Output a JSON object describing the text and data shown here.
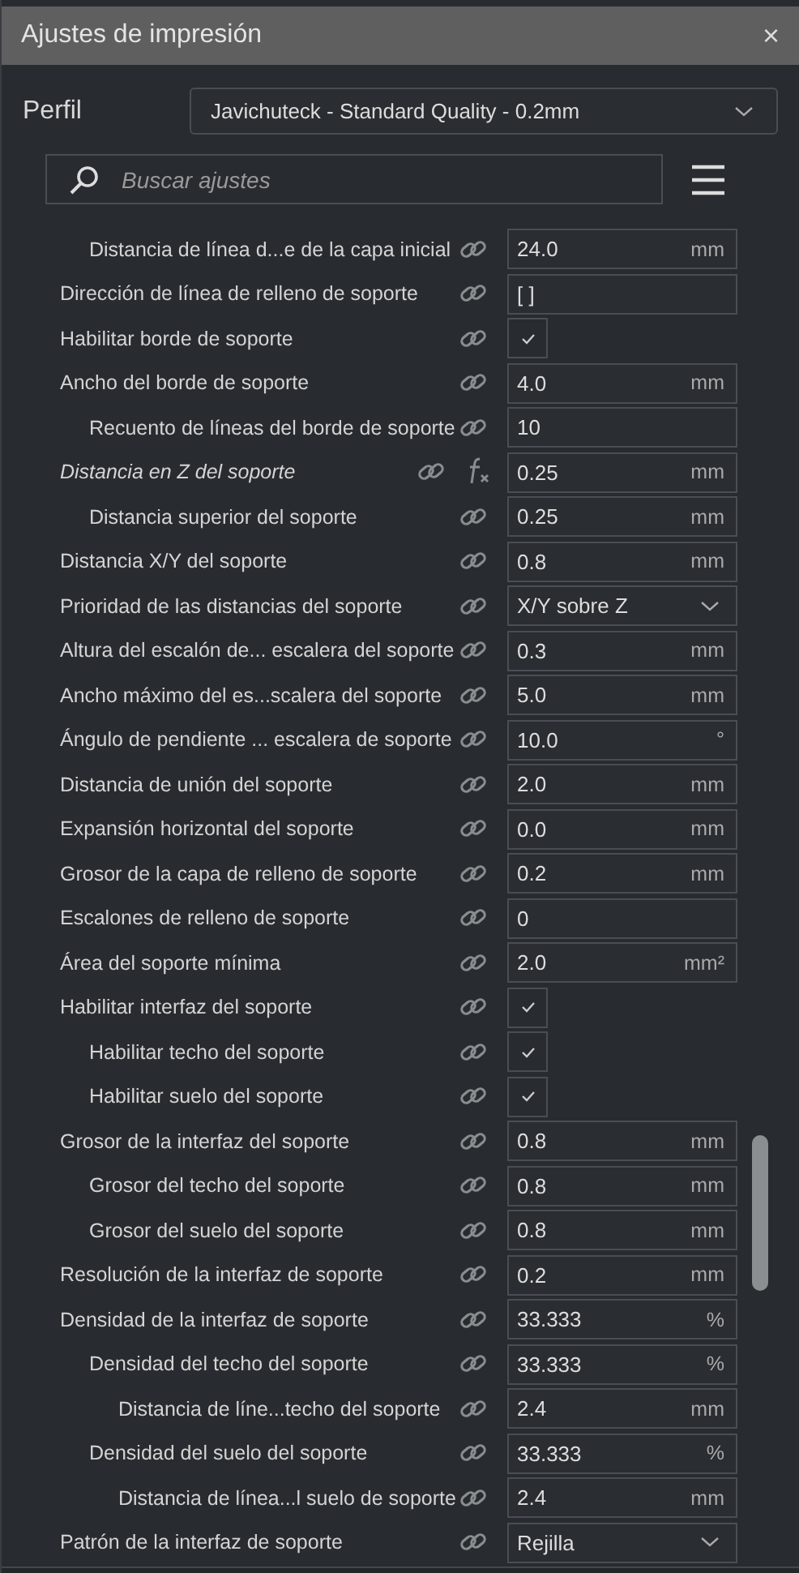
{
  "window": {
    "title": "Ajustes de impresión",
    "close": "×"
  },
  "profile": {
    "label": "Perfil",
    "value": "Javichuteck - Standard Quality - 0.2mm"
  },
  "search": {
    "placeholder": "Buscar ajustes"
  },
  "settings": [
    {
      "children": [
        {
          "label": "Distancia de línea d...e de la capa inicial",
          "kind": "number",
          "value": "24.0",
          "unit": "mm",
          "formula": false
        }
      ]
    },
    {
      "label": "Dirección de línea de relleno de soporte",
      "kind": "text",
      "value": "[ ]",
      "formula": false
    },
    {
      "label": "Habilitar borde de soporte",
      "kind": "checkbox",
      "checked": true,
      "formula": false
    },
    {
      "label": "Ancho del borde de soporte",
      "kind": "number",
      "value": "4.0",
      "unit": "mm",
      "formula": false,
      "children": [
        {
          "label": "Recuento de líneas del borde de soporte",
          "kind": "text",
          "value": "10",
          "formula": false
        }
      ]
    },
    {
      "label": "Distancia en Z del soporte",
      "kind": "number",
      "value": "0.25",
      "unit": "mm",
      "formula": true,
      "children": [
        {
          "label": "Distancia superior del soporte",
          "kind": "number",
          "value": "0.25",
          "unit": "mm",
          "formula": false
        }
      ]
    },
    {
      "label": "Distancia X/Y del soporte",
      "kind": "number",
      "value": "0.8",
      "unit": "mm",
      "formula": false
    },
    {
      "label": "Prioridad de las distancias del soporte",
      "kind": "dropdown",
      "value": "X/Y sobre Z",
      "formula": false
    },
    {
      "label": "Altura del escalón de... escalera del soporte",
      "kind": "number",
      "value": "0.3",
      "unit": "mm",
      "formula": false
    },
    {
      "label": "Ancho máximo del es...scalera del soporte",
      "kind": "number",
      "value": "5.0",
      "unit": "mm",
      "formula": false
    },
    {
      "label": "Ángulo de pendiente ... escalera de soporte",
      "kind": "number",
      "value": "10.0",
      "unit": "°",
      "formula": false
    },
    {
      "label": "Distancia de unión del soporte",
      "kind": "number",
      "value": "2.0",
      "unit": "mm",
      "formula": false
    },
    {
      "label": "Expansión horizontal del soporte",
      "kind": "number",
      "value": "0.0",
      "unit": "mm",
      "formula": false
    },
    {
      "label": "Grosor de la capa de relleno de soporte",
      "kind": "number",
      "value": "0.2",
      "unit": "mm",
      "formula": false
    },
    {
      "label": "Escalones de relleno de soporte",
      "kind": "text",
      "value": "0",
      "formula": false
    },
    {
      "label": "Área del soporte mínima",
      "kind": "number",
      "value": "2.0",
      "unit": "mm²",
      "formula": false
    },
    {
      "label": "Habilitar interfaz del soporte",
      "kind": "checkbox",
      "checked": true,
      "formula": false,
      "children": [
        {
          "label": "Habilitar techo del soporte",
          "kind": "checkbox",
          "checked": true,
          "formula": false
        },
        {
          "label": "Habilitar suelo del soporte",
          "kind": "checkbox",
          "checked": true,
          "formula": false
        }
      ]
    },
    {
      "label": "Grosor de la interfaz del soporte",
      "kind": "number",
      "value": "0.8",
      "unit": "mm",
      "formula": false,
      "children": [
        {
          "label": "Grosor del techo del soporte",
          "kind": "number",
          "value": "0.8",
          "unit": "mm",
          "formula": false
        },
        {
          "label": "Grosor del suelo del soporte",
          "kind": "number",
          "value": "0.8",
          "unit": "mm",
          "formula": false
        }
      ]
    },
    {
      "label": "Resolución de la interfaz de soporte",
      "kind": "number",
      "value": "0.2",
      "unit": "mm",
      "formula": false
    },
    {
      "label": "Densidad de la interfaz de soporte",
      "kind": "number",
      "value": "33.333",
      "unit": "%",
      "formula": false,
      "children": [
        {
          "label": "Densidad del techo del soporte",
          "kind": "number",
          "value": "33.333",
          "unit": "%",
          "formula": false,
          "children": [
            {
              "label": "Distancia de líne...techo del soporte",
              "kind": "number",
              "value": "2.4",
              "unit": "mm",
              "formula": false
            }
          ]
        },
        {
          "label": "Densidad del suelo del soporte",
          "kind": "number",
          "value": "33.333",
          "unit": "%",
          "formula": false,
          "children": [
            {
              "label": "Distancia de línea...l suelo de soporte",
              "kind": "number",
              "value": "2.4",
              "unit": "mm",
              "formula": false
            }
          ]
        }
      ]
    },
    {
      "label": "Patrón de la interfaz de soporte",
      "kind": "dropdown",
      "value": "Rejilla",
      "formula": false
    }
  ]
}
